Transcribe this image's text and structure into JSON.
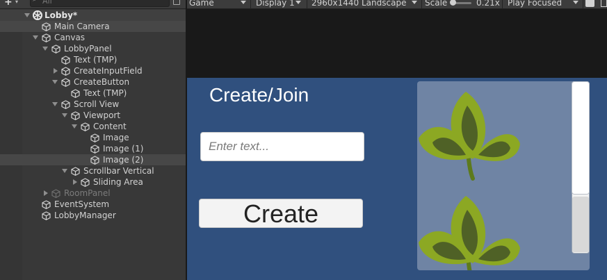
{
  "hierarchy": {
    "add_label": "+",
    "add_arrow": "▾",
    "search_placeholder": "All",
    "scene_name": "Lobby*",
    "menu_glyph": "⋮",
    "items": [
      {
        "label": "Main Camera"
      },
      {
        "label": "Canvas"
      },
      {
        "label": "LobbyPanel"
      },
      {
        "label": "Text (TMP)"
      },
      {
        "label": "CreateInputField"
      },
      {
        "label": "CreateButton"
      },
      {
        "label": "Text (TMP)"
      },
      {
        "label": "Scroll View"
      },
      {
        "label": "Viewport"
      },
      {
        "label": "Content"
      },
      {
        "label": "Image"
      },
      {
        "label": "Image (1)"
      },
      {
        "label": "Image (2)"
      },
      {
        "label": "Scrollbar Vertical"
      },
      {
        "label": "Sliding Area"
      },
      {
        "label": "RoomPanel"
      },
      {
        "label": "EventSystem"
      },
      {
        "label": "LobbyManager"
      }
    ]
  },
  "game_toolbar": {
    "view_label": "Game",
    "display_label": "Display 1",
    "resolution_label": "2960x1440 Landscape",
    "scale_label": "Scale",
    "scale_value": "0.21x",
    "play_mode_label": "Play Focused"
  },
  "game_ui": {
    "title": "Create/Join",
    "input_placeholder": "Enter text...",
    "create_button_label": "Create"
  },
  "colors": {
    "canvas_background": "#30507e",
    "leaf_light": "#8ca823",
    "leaf_dark": "#4f6126",
    "scroll_view_background": "#6f84a4"
  }
}
